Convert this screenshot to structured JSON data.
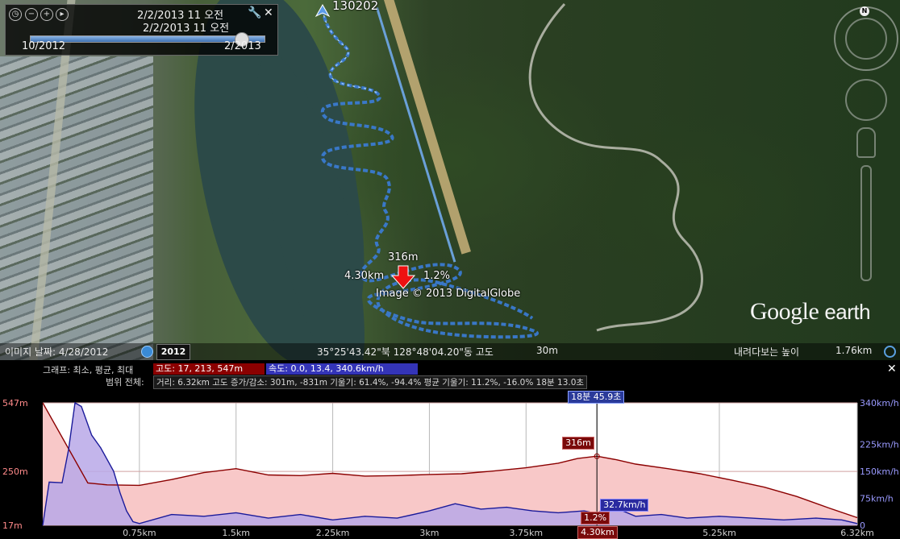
{
  "timeline": {
    "date_current": "2/2/2013  11 오전",
    "date_ghost": "2/2/2013  11 오전",
    "start_label": "10/2012",
    "end_label": "2/2013",
    "position": 0.9
  },
  "map": {
    "track_name": "130202",
    "marker_altitude": "316m",
    "marker_distance": "4.30km",
    "marker_grade": "1.2%",
    "copyright": "Image © 2013 DigitalGlobe",
    "logo_main": "Google",
    "logo_sub": "earth"
  },
  "statusbar": {
    "imagery_date": "이미지 날짜: 4/28/2012",
    "year": "2012",
    "coords": "35°25'43.42\"북  128°48'04.20\"동  고도",
    "elevation": "30m",
    "eye_alt_label": "내려다보는 높이",
    "eye_alt": "1.76km"
  },
  "graph_header": {
    "row1_label": "그래프: 최소, 평균, 최대",
    "altitude_stat": "고도: 17, 213, 547m",
    "speed_stat": "속도: 0.0, 13.4, 340.6km/h",
    "row2_label": "범위 전체:",
    "range_stat": "거리: 6.32km 고도 증가/감소: 301m, -831m 기울기: 61.4%, -94.4% 평균 기울기: 11.2%, -16.0% 18분 13.0초"
  },
  "cursor": {
    "time": "18분 45.9초",
    "altitude": "316m",
    "speed": "32.7km/h",
    "grade": "1.2%",
    "distance": "4.30km"
  },
  "colors": {
    "altitude": "#8b0000",
    "altitude_fill": "#f8c8c8",
    "speed": "#1a1a9a",
    "speed_fill": "#b8a8e8",
    "track": "#3a7ad0",
    "marker": "#e11"
  },
  "chart_data": {
    "type": "area",
    "x_ticks": [
      "0.75km",
      "1.5km",
      "2.25km",
      "3km",
      "3.75km",
      "4.30km",
      "5.25km",
      "6.32km"
    ],
    "left_ticks": [
      "547m",
      "250m",
      "17m"
    ],
    "right_ticks": [
      "340km/h",
      "225km/h",
      "150km/h",
      "75km/h",
      "0"
    ],
    "xlim": [
      0,
      6.32
    ],
    "ylim_left": [
      17,
      547
    ],
    "ylim_right": [
      0,
      340
    ],
    "series": [
      {
        "name": "고도",
        "x": [
          0,
          0.35,
          0.5,
          0.75,
          1.0,
          1.25,
          1.5,
          1.75,
          2.0,
          2.25,
          2.5,
          2.75,
          3.0,
          3.25,
          3.5,
          3.75,
          4.0,
          4.15,
          4.3,
          4.45,
          4.6,
          4.85,
          5.1,
          5.35,
          5.6,
          5.85,
          6.1,
          6.32
        ],
        "values": [
          547,
          200,
          192,
          190,
          215,
          245,
          262,
          235,
          232,
          242,
          230,
          232,
          237,
          240,
          252,
          266,
          286,
          306,
          316,
          301,
          282,
          262,
          240,
          212,
          182,
          142,
          92,
          50
        ]
      },
      {
        "name": "속도",
        "x": [
          0,
          0.05,
          0.15,
          0.2,
          0.25,
          0.3,
          0.38,
          0.45,
          0.55,
          0.6,
          0.65,
          0.7,
          0.75,
          1.0,
          1.25,
          1.5,
          1.75,
          2.0,
          2.25,
          2.5,
          2.75,
          3.0,
          3.2,
          3.4,
          3.6,
          3.8,
          4.0,
          4.2,
          4.3,
          4.4,
          4.6,
          4.8,
          5.0,
          5.25,
          5.5,
          5.75,
          6.0,
          6.2,
          6.32
        ],
        "values": [
          0,
          120,
          118,
          210,
          340,
          330,
          250,
          215,
          150,
          90,
          40,
          10,
          5,
          30,
          25,
          35,
          20,
          30,
          15,
          25,
          20,
          40,
          60,
          45,
          50,
          40,
          35,
          40,
          32.7,
          55,
          25,
          30,
          20,
          25,
          20,
          15,
          20,
          15,
          5
        ]
      }
    ]
  }
}
